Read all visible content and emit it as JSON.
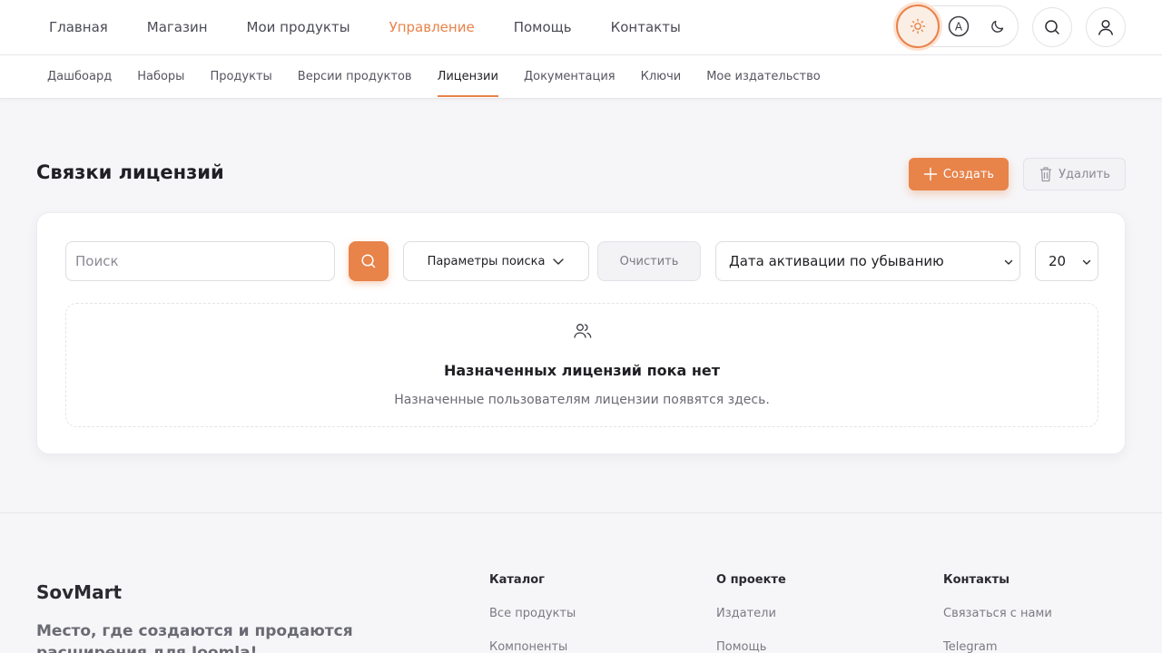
{
  "nav": {
    "items": [
      "Главная",
      "Магазин",
      "Мои продукты",
      "Управление",
      "Помощь",
      "Контакты"
    ],
    "active_index": 3,
    "theme_auto_label": "A"
  },
  "subnav": {
    "items": [
      "Дашбоард",
      "Наборы",
      "Продукты",
      "Версии продуктов",
      "Лицензии",
      "Документация",
      "Ключи",
      "Мое издательство"
    ],
    "active_index": 4
  },
  "page": {
    "title": "Связки лицензий",
    "create_label": "Создать",
    "delete_label": "Удалить"
  },
  "filters": {
    "search_placeholder": "Поиск",
    "params_label": "Параметры поиска",
    "clear_label": "Очистить",
    "sort_selected": "Дата активации по убыванию",
    "per_page": "20"
  },
  "empty": {
    "title": "Назначенных лицензий пока нет",
    "description": "Назначенные пользователям лицензии появятся здесь."
  },
  "footer": {
    "brand": "SovMart",
    "tagline": "Место, где создаются и продаются расширения для Joomla!",
    "columns": [
      {
        "heading": "Каталог",
        "links": [
          "Все продукты",
          "Компоненты"
        ]
      },
      {
        "heading": "О проекте",
        "links": [
          "Издатели",
          "Помощь"
        ]
      },
      {
        "heading": "Контакты",
        "links": [
          "Связаться с нами",
          "Telegram"
        ]
      }
    ]
  },
  "colors": {
    "accent": "#e8834a"
  }
}
